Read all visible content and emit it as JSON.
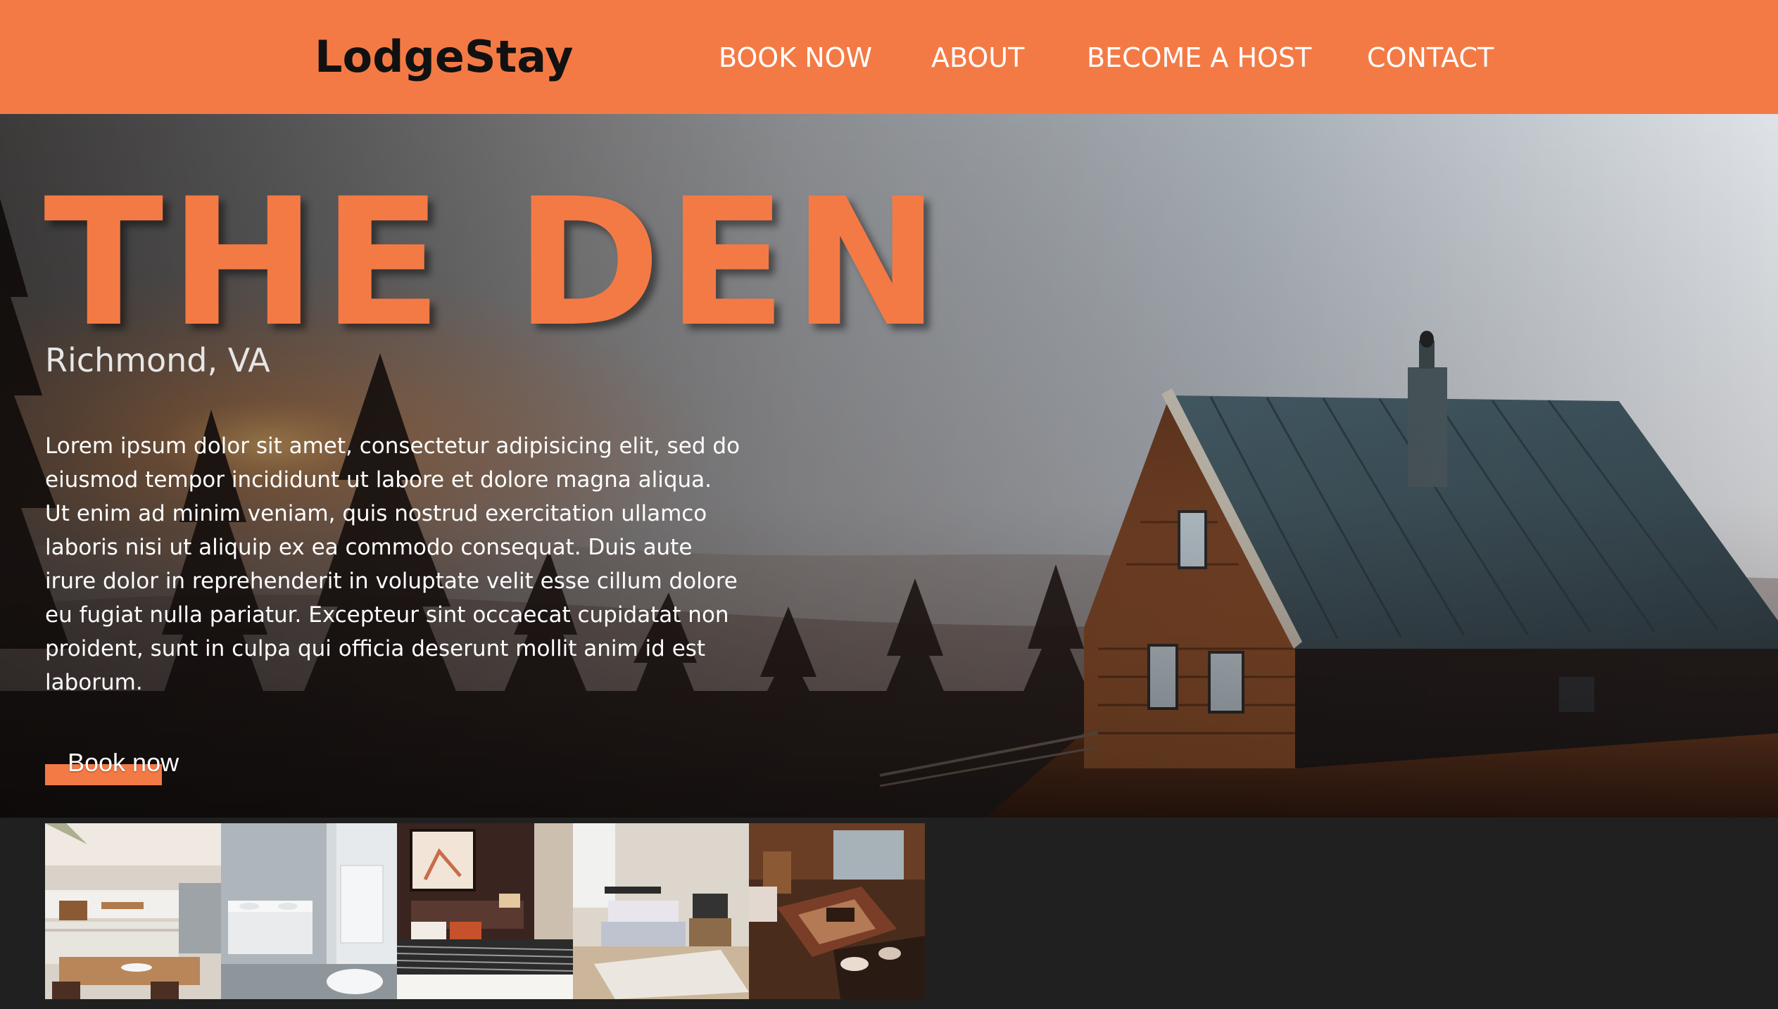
{
  "site": {
    "logo": "LodgeStay",
    "brand_color": "#f47a45"
  },
  "nav": {
    "items": [
      {
        "label": "BOOK NOW"
      },
      {
        "label": "ABOUT"
      },
      {
        "label": "BECOME A HOST"
      },
      {
        "label": "CONTACT"
      }
    ]
  },
  "hero": {
    "title": "THE DEN",
    "location": "Richmond, VA",
    "description": "Lorem ipsum dolor sit amet, consectetur adipisicing elit, sed do eiusmod tempor incididunt ut labore et dolore magna aliqua. Ut enim ad minim veniam, quis nostrud exercitation ullamco laboris nisi ut aliquip ex ea commodo consequat. Duis aute irure dolor in reprehenderit in voluptate velit esse cillum dolore eu fugiat nulla pariatur. Excepteur sint occaecat cupidatat non proident, sunt in culpa qui officia deserunt mollit anim id est laborum.",
    "cta_label": "Book now"
  },
  "gallery": {
    "photos": [
      {
        "subject": "kitchen"
      },
      {
        "subject": "bathroom"
      },
      {
        "subject": "bedroom-dark"
      },
      {
        "subject": "bedroom-light"
      },
      {
        "subject": "living-room"
      }
    ]
  }
}
